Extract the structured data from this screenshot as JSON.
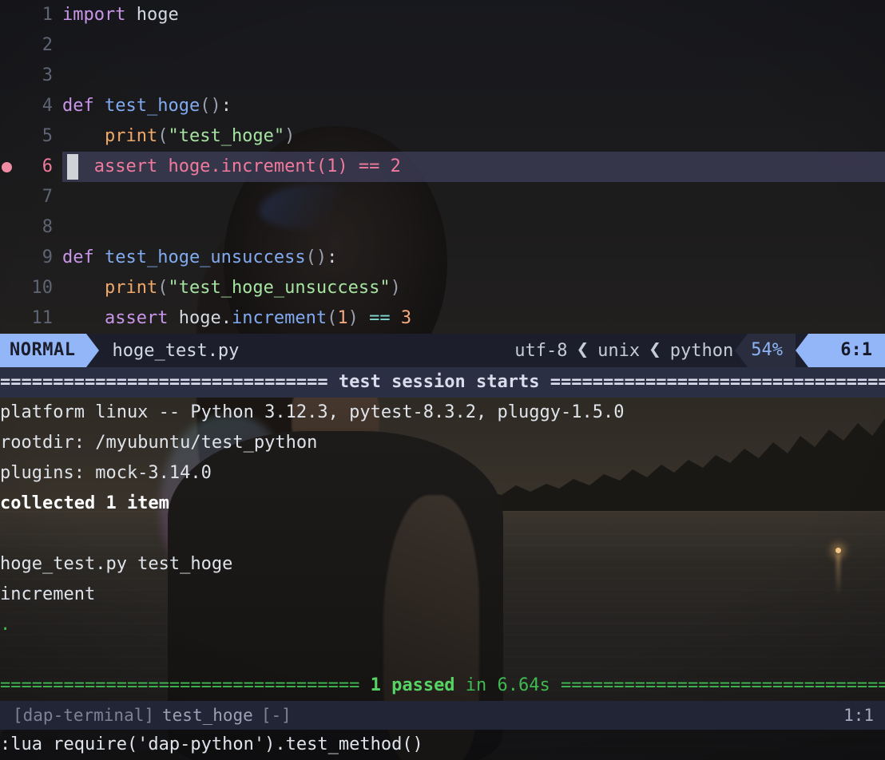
{
  "editor": {
    "lines": [
      {
        "num": "1",
        "tokens": [
          {
            "t": "import ",
            "c": "kw"
          },
          {
            "t": "hoge",
            "c": "plain"
          }
        ]
      },
      {
        "num": "2",
        "tokens": []
      },
      {
        "num": "3",
        "tokens": []
      },
      {
        "num": "4",
        "tokens": [
          {
            "t": "def ",
            "c": "kw"
          },
          {
            "t": "test_hoge",
            "c": "fn"
          },
          {
            "t": "()",
            "c": "punct"
          },
          {
            "t": ":",
            "c": "plain"
          }
        ]
      },
      {
        "num": "5",
        "tokens": [
          {
            "t": "    ",
            "c": "plain"
          },
          {
            "t": "print",
            "c": "fnbi"
          },
          {
            "t": "(",
            "c": "punct"
          },
          {
            "t": "\"test_hoge\"",
            "c": "str"
          },
          {
            "t": ")",
            "c": "punct"
          }
        ]
      },
      {
        "num": "6",
        "breakpoint": true,
        "current": true,
        "tokens": [
          {
            "t": "   assert hoge.increment(1) == 2",
            "c": "bpline"
          }
        ]
      },
      {
        "num": "7",
        "tokens": []
      },
      {
        "num": "8",
        "tokens": []
      },
      {
        "num": "9",
        "tokens": [
          {
            "t": "def ",
            "c": "kw"
          },
          {
            "t": "test_hoge_unsuccess",
            "c": "fn"
          },
          {
            "t": "()",
            "c": "punct"
          },
          {
            "t": ":",
            "c": "plain"
          }
        ]
      },
      {
        "num": "10",
        "tokens": [
          {
            "t": "    ",
            "c": "plain"
          },
          {
            "t": "print",
            "c": "fnbi"
          },
          {
            "t": "(",
            "c": "punct"
          },
          {
            "t": "\"test_hoge_unsuccess\"",
            "c": "str"
          },
          {
            "t": ")",
            "c": "punct"
          }
        ]
      },
      {
        "num": "11",
        "tokens": [
          {
            "t": "    ",
            "c": "plain"
          },
          {
            "t": "assert",
            "c": "kw"
          },
          {
            "t": " hoge.",
            "c": "plain"
          },
          {
            "t": "increment",
            "c": "fn"
          },
          {
            "t": "(",
            "c": "punct"
          },
          {
            "t": "1",
            "c": "num"
          },
          {
            "t": ")",
            "c": "punct"
          },
          {
            "t": " ",
            "c": "plain"
          },
          {
            "t": "==",
            "c": "op"
          },
          {
            "t": " ",
            "c": "plain"
          },
          {
            "t": "3",
            "c": "num"
          }
        ]
      }
    ]
  },
  "statusline": {
    "mode": "NORMAL",
    "filename": "hoge_test.py",
    "encoding": "utf-8",
    "fileformat": "unix",
    "filetype": "python",
    "chevron": "❮",
    "percent": "54%",
    "position": "6:1",
    "colors": {
      "mode_bg": "#93b6f9",
      "pct_bg": "#2a2d3e",
      "bar_bg": "#1c1e2b"
    }
  },
  "terminal": {
    "header": "=============================== test session starts ================================",
    "lines": [
      {
        "segments": [
          {
            "t": "platform linux -- Python 3.12.3, pytest-8.3.2, pluggy-1.5.0",
            "c": "t-plain"
          }
        ]
      },
      {
        "segments": [
          {
            "t": "rootdir: /myubuntu/test_python",
            "c": "t-plain"
          }
        ]
      },
      {
        "segments": [
          {
            "t": "plugins: mock-3.14.0",
            "c": "t-plain"
          }
        ]
      },
      {
        "segments": [
          {
            "t": "collected 1 item",
            "c": "t-bold"
          }
        ]
      },
      {
        "segments": []
      },
      {
        "segments": [
          {
            "t": "hoge_test.py test_hoge",
            "c": "t-plain"
          }
        ]
      },
      {
        "segments": [
          {
            "t": "increment",
            "c": "t-plain"
          }
        ]
      },
      {
        "segments": [
          {
            "t": ".",
            "c": "t-dot"
          }
        ]
      },
      {
        "segments": []
      }
    ],
    "summary": [
      {
        "t": "================================== ",
        "c": "t-green"
      },
      {
        "t": "1 passed",
        "c": "t-green-bold"
      },
      {
        "t": " in ",
        "c": "t-green"
      },
      {
        "t": "6.64s",
        "c": "t-green"
      },
      {
        "t": " ==================================",
        "c": "t-green"
      }
    ]
  },
  "terminal_footer": {
    "tag": "[dap-terminal]",
    "name": "test_hoge",
    "modified": "[-]",
    "position": "1:1"
  },
  "cmdline": {
    "text": ":lua require('dap-python').test_method()"
  }
}
